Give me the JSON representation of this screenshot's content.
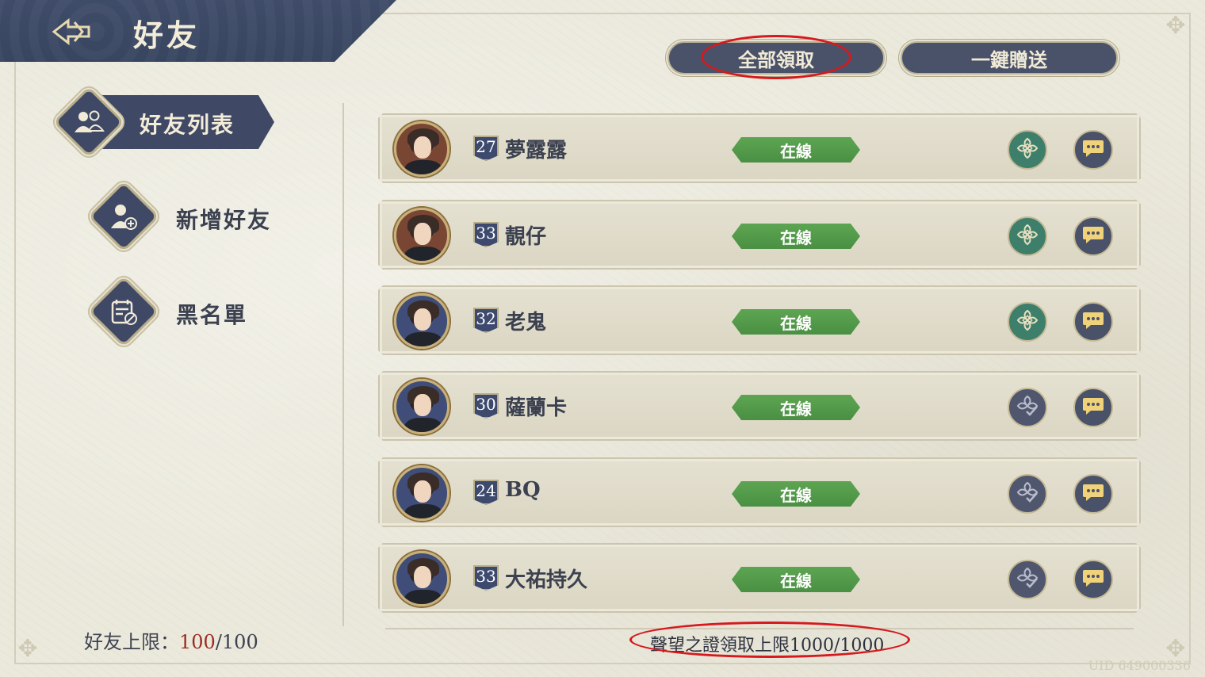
{
  "header": {
    "title": "好友"
  },
  "menu": {
    "friend_list": "好友列表",
    "add_friend": "新增好友",
    "blacklist": "黑名單"
  },
  "friend_limit": {
    "label": "好友上限：",
    "current": "100",
    "max": "/100"
  },
  "buttons": {
    "claim_all": "全部領取",
    "send_all": "一鍵贈送"
  },
  "friends": [
    {
      "level": "27",
      "name": "夢露露",
      "status": "在線",
      "gift_state": "available"
    },
    {
      "level": "33",
      "name": "靚仔",
      "status": "在線",
      "gift_state": "available"
    },
    {
      "level": "32",
      "name": "老鬼",
      "status": "在線",
      "gift_state": "available"
    },
    {
      "level": "30",
      "name": "薩蘭卡",
      "status": "在線",
      "gift_state": "claimed"
    },
    {
      "level": "24",
      "name": "BQ",
      "status": "在線",
      "gift_state": "claimed"
    },
    {
      "level": "33",
      "name": "大祐持久",
      "status": "在線",
      "gift_state": "claimed"
    }
  ],
  "reputation_limit": "聲望之證領取上限1000/1000",
  "uid": "UID 649000336",
  "colors": {
    "accent_navy": "#3f4966",
    "online_green": "#5da552",
    "annotation_red": "#d7191e",
    "limit_red": "#9b2b22"
  }
}
